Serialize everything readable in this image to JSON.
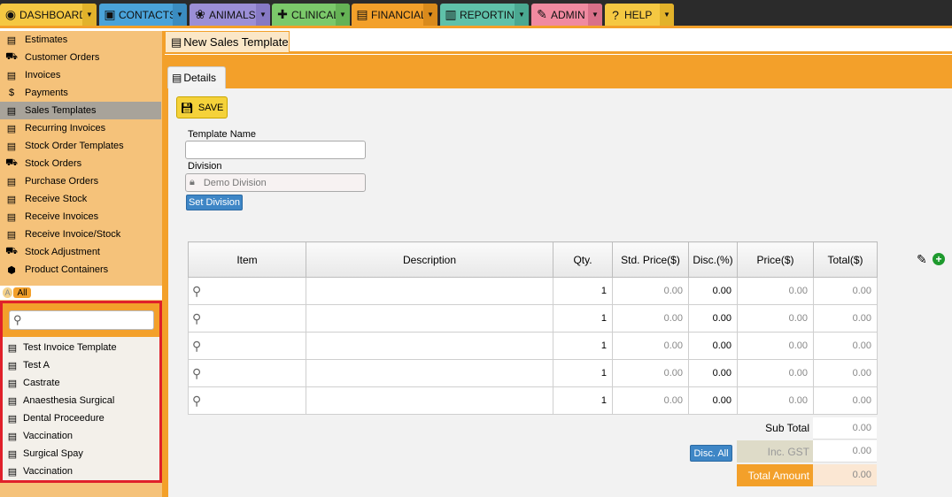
{
  "nav": {
    "tabs": [
      {
        "label": "DASHBOARD",
        "icon": "dashboard-icon",
        "color": "#f5c842",
        "caret": "#f5c842"
      },
      {
        "label": "CONTACTS",
        "icon": "contacts-icon",
        "color": "#4aa3d9",
        "caret": "#4aa3d9"
      },
      {
        "label": "ANIMALS",
        "icon": "paw-icon",
        "color": "#9b8fd6",
        "caret": "#9b8fd6"
      },
      {
        "label": "CLINICAL",
        "icon": "clinical-icon",
        "color": "#7bc96a",
        "caret": "#7bc96a"
      },
      {
        "label": "FINANCIAL",
        "icon": "financial-icon",
        "color": "#f3a02a",
        "caret": "#f3a02a"
      },
      {
        "label": "REPORTING",
        "icon": "reporting-icon",
        "color": "#5fc1a9",
        "caret": "#5fc1a9"
      },
      {
        "label": "ADMIN",
        "icon": "wrench-icon",
        "color": "#f08aa0",
        "caret": "#f08aa0"
      },
      {
        "label": "HELP",
        "icon": "help-icon",
        "color": "#f5c842",
        "caret": "#f5c842"
      }
    ]
  },
  "sidebar": {
    "items": [
      {
        "label": "Estimates",
        "icon": "estimates-icon"
      },
      {
        "label": "Customer Orders",
        "icon": "cart-icon"
      },
      {
        "label": "Invoices",
        "icon": "invoice-icon"
      },
      {
        "label": "Payments",
        "icon": "payments-icon"
      },
      {
        "label": "Sales Templates",
        "icon": "sales-template-icon",
        "active": true
      },
      {
        "label": "Recurring Invoices",
        "icon": "recurring-invoice-icon"
      },
      {
        "label": "Stock Order Templates",
        "icon": "stock-order-template-icon"
      },
      {
        "label": "Stock Orders",
        "icon": "truck-icon"
      },
      {
        "label": "Purchase Orders",
        "icon": "purchase-order-icon"
      },
      {
        "label": "Receive Stock",
        "icon": "receive-stock-icon"
      },
      {
        "label": "Receive Invoices",
        "icon": "receive-invoice-icon"
      },
      {
        "label": "Receive Invoice/Stock",
        "icon": "receive-invoice-stock-icon"
      },
      {
        "label": "Stock Adjustment",
        "icon": "stock-adjustment-icon"
      },
      {
        "label": "Product Containers",
        "icon": "container-icon"
      }
    ],
    "filter": {
      "a": "A",
      "all": "All"
    },
    "templates": [
      "Test Invoice Template",
      "Test A",
      "Castrate",
      "Anaesthesia Surgical",
      "Dental Proceedure",
      "Vaccination",
      "Surgical Spay",
      "Vaccination"
    ]
  },
  "page": {
    "tab_title": "New Sales Template"
  },
  "details": {
    "tab_label": "Details",
    "save_label": "SAVE",
    "template_name_label": "Template Name",
    "template_name_value": "",
    "division_label": "Division",
    "division_value": "Demo Division",
    "set_division_label": "Set Division"
  },
  "grid": {
    "headers": [
      "Item",
      "Description",
      "Qty.",
      "Std. Price($)",
      "Disc.(%)",
      "Price($)",
      "Total($)"
    ],
    "rows": [
      {
        "qty": "1",
        "std_price": "0.00",
        "disc": "0.00",
        "price": "0.00",
        "total": "0.00"
      },
      {
        "qty": "1",
        "std_price": "0.00",
        "disc": "0.00",
        "price": "0.00",
        "total": "0.00"
      },
      {
        "qty": "1",
        "std_price": "0.00",
        "disc": "0.00",
        "price": "0.00",
        "total": "0.00"
      },
      {
        "qty": "1",
        "std_price": "0.00",
        "disc": "0.00",
        "price": "0.00",
        "total": "0.00"
      },
      {
        "qty": "1",
        "std_price": "0.00",
        "disc": "0.00",
        "price": "0.00",
        "total": "0.00"
      }
    ]
  },
  "totals": {
    "sub_total_label": "Sub Total",
    "sub_total": "0.00",
    "gst_label": "Inc. GST",
    "gst": "0.00",
    "total_label": "Total Amount",
    "total": "0.00",
    "disc_all_label": "Disc. All"
  }
}
